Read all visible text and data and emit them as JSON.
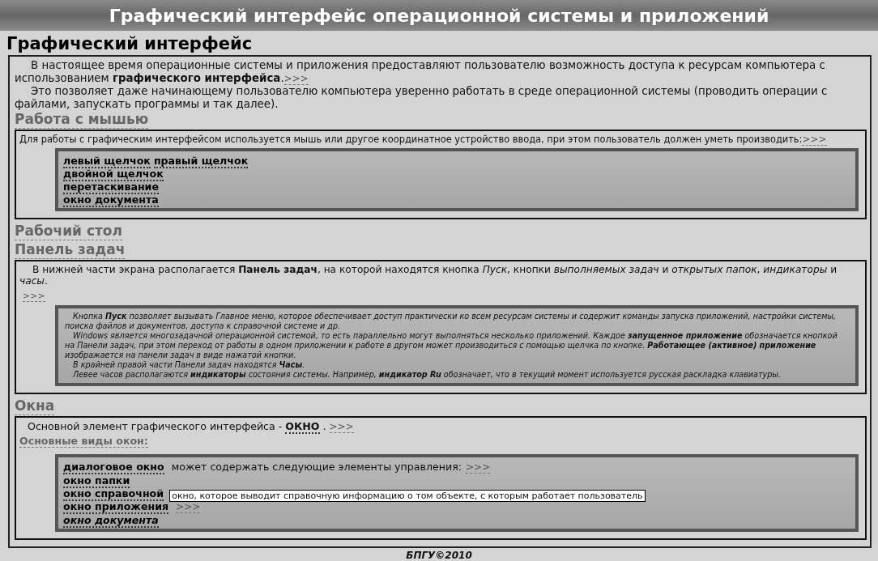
{
  "header": {
    "title": "Графический интерфейс операционной системы и приложений"
  },
  "page_title": "Графический интерфейс",
  "intro": {
    "paragraphs": [
      "В настоящее время операционные системы и приложения предоставляют пользователю возможность доступа к ресурсам компьютера с использованием **графического интерфейса**.",
      "Это позволяет даже начинающему пользователю компьютера уверенно работать в среде операционной системы (проводить операции с файлами, запускать программы и так далее)."
    ],
    "more": ">>>"
  },
  "sections": [
    {
      "kind": "links",
      "heading": "Работа с мышью",
      "text": "Для работы с графическим интерфейсом используется мышь или другое координатное устройство ввода, при этом пользователь должен уметь производить:",
      "more": ">>>",
      "rows": [
        [
          "левый щелчок",
          "правый щелчок"
        ],
        [
          "двойной щелчок"
        ],
        [
          "перетаскивание"
        ],
        [
          "окно документа"
        ]
      ]
    },
    {
      "kind": "heading",
      "heading": "Рабочий стол"
    },
    {
      "kind": "notes",
      "heading": "Панель задач",
      "text": "В нижней части экрана располагается **Панель задач**, на которой находятся кнопка *Пуск*, кнопки *выполняемых задач* и *открытых папок*, *индикаторы* и *часы*.",
      "more": ">>>",
      "notes": [
        "Кнопка **Пуск** позволяет вызывать Главное меню, которое обеспечивает доступ практически ко всем ресурсам системы и содержит команды запуска приложений, настройки системы, поиска файлов и документов, доступа к справочной системе и др.",
        "Windows является многозадачной операционной системой, то есть параллельно могут выполняться несколько приложений. Каждое **запущенное приложение** обозначается кнопкой на Панели задач, при этом переход от работы в одном приложении к работе в другом может производиться с помощью щелчка по кнопке. **Работающее (активное) приложение** изображается на панели задач в виде нажатой кнопки.",
        "В крайней правой части Панели задач находятся **Часы**.",
        "Левее часов располагаются **индикаторы** состояния системы. Например, **индикатор Ru** обозначает, что в текущий момент используется русская раскладка клавиатуры."
      ]
    },
    {
      "kind": "windows",
      "heading": "Окна",
      "text_before": "Основной элемент графического интерфейса - ",
      "keyword": "ОКНО",
      "text_after": " . ",
      "more": ">>>",
      "subheading": "Основные виды окон:",
      "items": [
        {
          "label": "диалоговое окно",
          "italic": false,
          "note": "может содержать следующие элементы управления:",
          "more": ">>>"
        },
        {
          "label": "окно папки",
          "italic": false
        },
        {
          "label": "окно справочной",
          "italic": false,
          "tooltip": "окно, которое выводит справочную информацию о том объекте, с которым работает пользователь"
        },
        {
          "label": "окно приложения",
          "italic": false,
          "more": ">>>"
        },
        {
          "label": "окно документа",
          "italic": true
        }
      ]
    }
  ],
  "footer": "БПГУ©2010"
}
